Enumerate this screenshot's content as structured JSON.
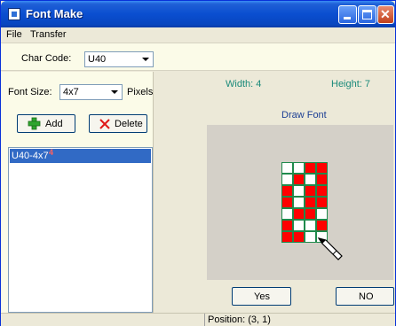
{
  "window": {
    "title": "Font Make"
  },
  "menu": {
    "items": [
      "File",
      "Transfer"
    ]
  },
  "char_code": {
    "label": "Char Code:",
    "value": "U40"
  },
  "font_size": {
    "label": "Font Size:",
    "value": "4x7",
    "unit": "Pixels"
  },
  "buttons": {
    "add": "Add",
    "delete": "Delete",
    "yes": "Yes",
    "no": "NO"
  },
  "list": {
    "items": [
      {
        "label": "U40-4x7",
        "badge": "4",
        "selected": true
      }
    ]
  },
  "dims": {
    "width": "Width: 4",
    "height": "Height: 7"
  },
  "draw": {
    "title": "Draw Font"
  },
  "grid": {
    "cols": 4,
    "rows": 7,
    "pixels": [
      [
        0,
        0,
        1,
        1
      ],
      [
        0,
        1,
        0,
        1
      ],
      [
        1,
        0,
        1,
        1
      ],
      [
        1,
        0,
        1,
        1
      ],
      [
        0,
        1,
        1,
        0
      ],
      [
        1,
        0,
        0,
        1
      ],
      [
        1,
        1,
        0,
        0
      ]
    ],
    "on_color": "#ff0000",
    "off_color": "#ffffff",
    "line_color": "#1f8a4c"
  },
  "status": {
    "position": "Position: (3, 1)"
  }
}
